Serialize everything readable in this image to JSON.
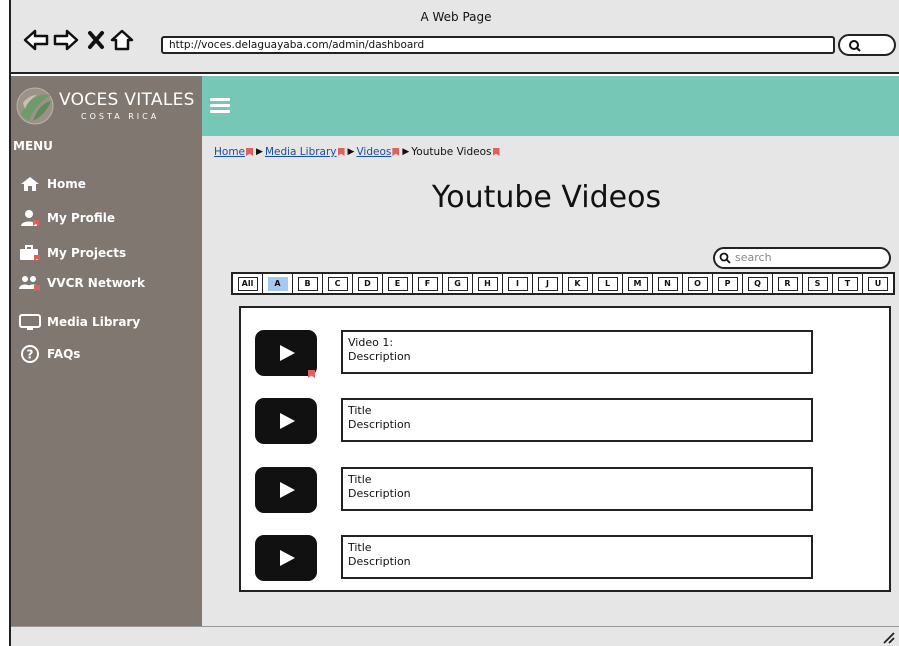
{
  "browser": {
    "window_title": "A Web Page",
    "url": "http://voces.delaguayaba.com/admin/dashboard"
  },
  "logo": {
    "title": "VOCES VITALES",
    "subtitle": "COSTA RICA"
  },
  "sidebar": {
    "menu_label": "MENU",
    "items": [
      {
        "label": "Home",
        "icon": "home-icon"
      },
      {
        "label": "My Profile",
        "icon": "user-icon"
      },
      {
        "label": "My Projects",
        "icon": "briefcase-icon"
      },
      {
        "label": "VVCR Network",
        "icon": "group-icon"
      },
      {
        "label": "Media Library",
        "icon": "monitor-icon"
      },
      {
        "label": "FAQs",
        "icon": "question-icon"
      }
    ]
  },
  "breadcrumb": {
    "items": [
      "Home",
      "Media Library",
      "Videos"
    ],
    "current": "Youtube Videos"
  },
  "page": {
    "title": "Youtube Videos",
    "search_placeholder": "search"
  },
  "letters": [
    "All",
    "A",
    "B",
    "C",
    "D",
    "E",
    "F",
    "G",
    "H",
    "I",
    "J",
    "K",
    "L",
    "M",
    "N",
    "O",
    "P",
    "Q",
    "R",
    "S",
    "T",
    "U"
  ],
  "active_letter": "A",
  "videos": [
    {
      "title": "Video 1:",
      "description": "Description"
    },
    {
      "title": "Title",
      "description": "Description"
    },
    {
      "title": "Title",
      "description": "Description"
    },
    {
      "title": "Title",
      "description": "Description"
    }
  ],
  "colors": {
    "header": "#77c7b7",
    "sidebar": "#7f7770",
    "content_bg": "#e6e6e6",
    "active_letter": "#a7c8f0"
  }
}
